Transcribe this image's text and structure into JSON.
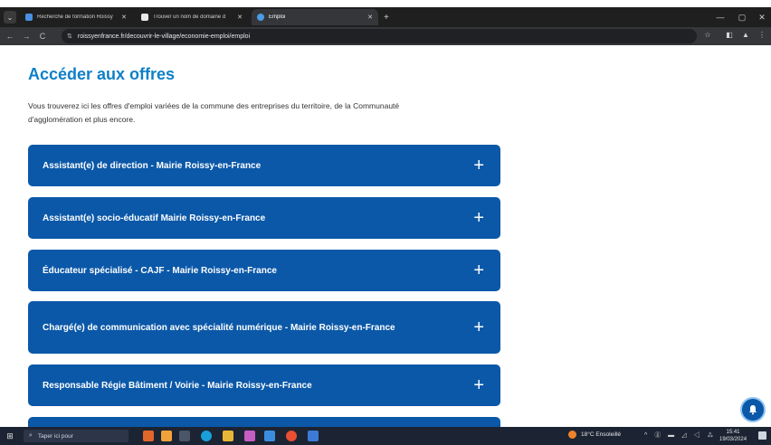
{
  "browser": {
    "tabs": [
      {
        "title": "Recherche de formation Roissy",
        "favicon_color": "#4a90e2",
        "active": false
      },
      {
        "title": "Trouver un nom de domaine d",
        "favicon_color": "#e8e8e8",
        "active": false
      },
      {
        "title": "Emploi",
        "favicon_color": "#4a9be8",
        "active": true
      }
    ],
    "tab_close_glyph": "✕",
    "new_tab_glyph": "+",
    "menu_glyph": "⌄",
    "window_controls": {
      "minimize": "—",
      "maximize": "▢",
      "close": "✕"
    },
    "nav": {
      "back": "←",
      "forward": "→",
      "reload": "C"
    },
    "url": "roissyenfrance.fr/decouvrir-le-village/economie-emploi/emploi",
    "site_info_glyph": "⇅",
    "toolbar_icons": {
      "bookmark": "☆",
      "sidepanel": "◧",
      "profile": "▲",
      "menu": "⋮"
    }
  },
  "page": {
    "title": "Accéder aux offres",
    "intro": "Vous trouverez ici les offres d'emploi variées de la commune des entreprises du territoire, de la Communauté d'agglomération et plus encore.",
    "offers": [
      {
        "label": "Assistant(e) de direction - Mairie Roissy-en-France"
      },
      {
        "label": "Assistant(e) socio-éducatif Mairie Roissy-en-France"
      },
      {
        "label": "Éducateur spécialisé - CAJF - Mairie Roissy-en-France"
      },
      {
        "label": "Chargé(e) de communication avec spécialité numérique - Mairie Roissy-en-France"
      },
      {
        "label": "Responsable Régie Bâtiment / Voirie - Mairie Roissy-en-France"
      },
      {
        "label": ""
      }
    ],
    "expand_glyph": "+",
    "accent_color": "#0b58a8",
    "title_color": "#0e7fc7"
  },
  "taskbar": {
    "start_glyph": "⊞",
    "search_glyph": "⌕",
    "search_placeholder": "Taper ici pour",
    "weather": "18°C Ensoleillé",
    "tray_icons": "^ ⓖ ▬ ◿ ◁ ⁂",
    "time": "15:41",
    "date": "19/03/2024"
  }
}
